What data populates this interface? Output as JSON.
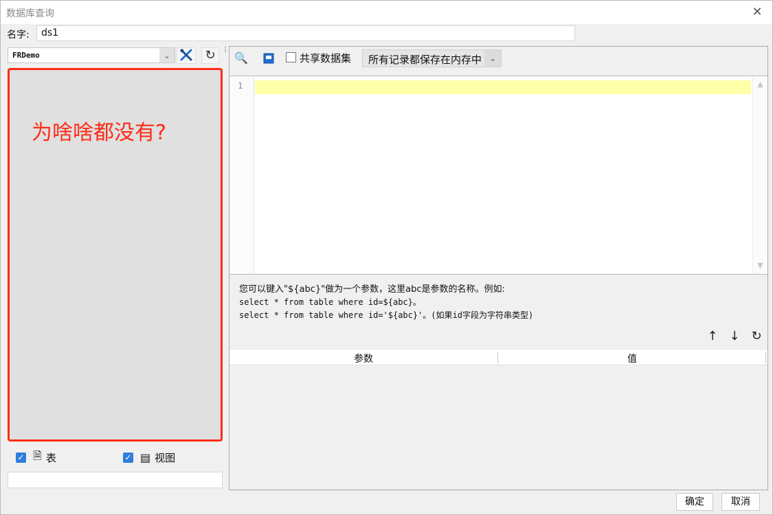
{
  "window": {
    "title": "数据库查询"
  },
  "name_row": {
    "label": "名字:",
    "value": "ds1"
  },
  "left": {
    "connection": "FRDemo",
    "annotation": "为啥啥都没有?",
    "tables_label": "表",
    "views_label": "视图",
    "tables_checked": true,
    "views_checked": true
  },
  "right": {
    "share_label": "共享数据集",
    "memory_option": "所有记录都保存在内存中",
    "line_number": "1",
    "hint_line1": "您可以键入\"${abc}\"做为一个参数，这里abc是参数的名称。例如:",
    "hint_line2": "select * from table where id=${abc}。",
    "hint_line3": "select * from table where id='${abc}'。(如果id字段为字符串类型)",
    "param_header": "参数",
    "value_header": "值"
  },
  "footer": {
    "ok": "确定",
    "cancel": "取消"
  },
  "colors": {
    "annotation_red": "#ff2a16",
    "checkbox_blue": "#2f7ddc",
    "line_highlight": "#ffffa8"
  }
}
